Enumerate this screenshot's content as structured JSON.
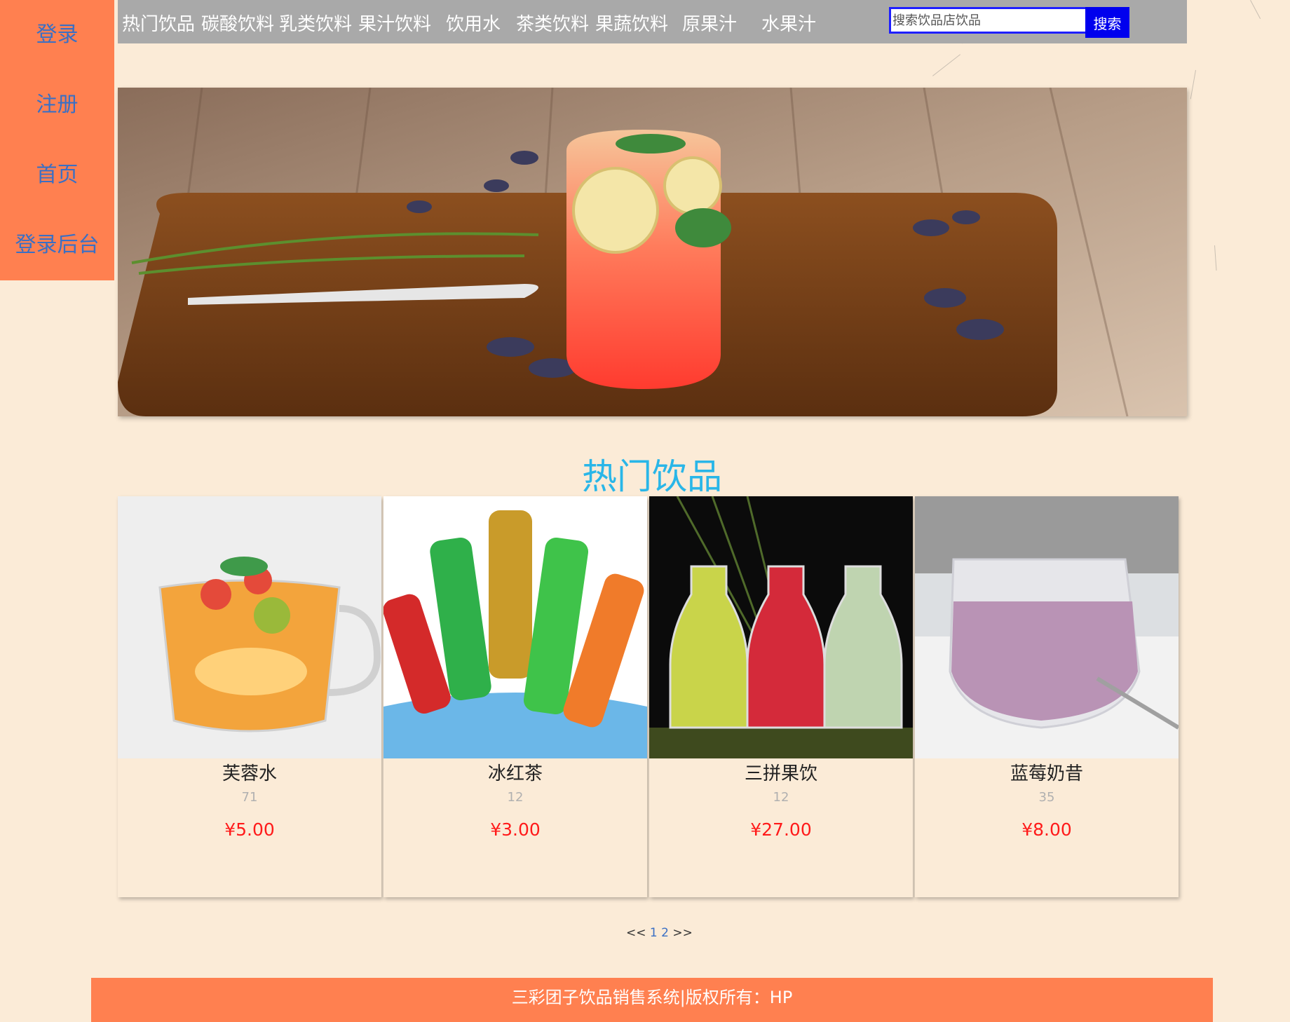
{
  "side_menu": {
    "login": "登录",
    "register": "注册",
    "home": "首页",
    "admin_login": "登录后台"
  },
  "nav": {
    "items": [
      "热门饮品",
      "碳酸饮料",
      "乳类饮料",
      "果汁饮料",
      "饮用水",
      "茶类饮料",
      "果蔬饮料",
      "原果汁",
      "水果汁"
    ]
  },
  "search": {
    "placeholder": "搜索饮品店饮品",
    "button_label": "搜索"
  },
  "section_title": "热门饮品",
  "products": [
    {
      "name": "芙蓉水",
      "sales": "71",
      "price": "¥5.00"
    },
    {
      "name": "冰红茶",
      "sales": "12",
      "price": "¥3.00"
    },
    {
      "name": "三拼果饮",
      "sales": "12",
      "price": "¥27.00"
    },
    {
      "name": "蓝莓奶昔",
      "sales": "35",
      "price": "¥8.00"
    }
  ],
  "pagination": {
    "prev": "<<",
    "pages": [
      "1",
      "2"
    ],
    "next": ">>"
  },
  "footer": {
    "text": "三彩团子饮品销售系统|版权所有：HP"
  },
  "colors": {
    "page_bg": "#fbebd7",
    "side_menu_bg": "#ff8050",
    "nav_bg": "#a9a9a9",
    "search_button_bg": "#0000ee",
    "section_title": "#29b6e8",
    "price": "#ff1a1a",
    "link": "#3a6fc4"
  }
}
